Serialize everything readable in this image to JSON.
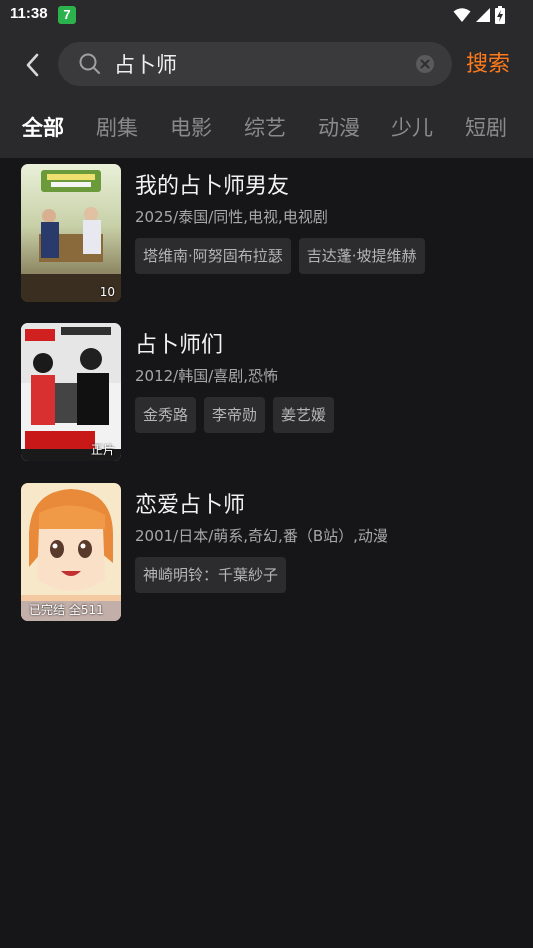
{
  "status_bar": {
    "time": "11:38",
    "notification_badge": "7",
    "icons": [
      "wifi-icon",
      "signal-icon",
      "battery-icon"
    ]
  },
  "header": {
    "back_icon": "chevron-left-icon",
    "search": {
      "value": "占卜师",
      "icon": "search-icon",
      "clear_icon": "clear-icon"
    },
    "search_button_label": "搜索",
    "accent_color": "#ff7a1a"
  },
  "tabs": [
    {
      "label": "全部",
      "active": true
    },
    {
      "label": "剧集",
      "active": false
    },
    {
      "label": "电影",
      "active": false
    },
    {
      "label": "综艺",
      "active": false
    },
    {
      "label": "动漫",
      "active": false
    },
    {
      "label": "少儿",
      "active": false
    },
    {
      "label": "短剧",
      "active": false
    }
  ],
  "results": [
    {
      "title": "我的占卜师男友",
      "meta": "2025/泰国/同性,电视,电视剧",
      "badge": "10",
      "tags": [
        "塔维南·阿努固布拉瑟",
        "吉达蓬·坡提维赫"
      ]
    },
    {
      "title": "占卜师们",
      "meta": "2012/韩国/喜剧,恐怖",
      "badge": "正片",
      "tags": [
        "金秀路",
        "李帝勋",
        "姜艺媛"
      ]
    },
    {
      "title": "恋爱占卜师",
      "meta": "2001/日本/萌系,奇幻,番（B站）,动漫",
      "badge": "已完结 全511",
      "tags": [
        "神崎明铃：千葉紗子"
      ]
    }
  ]
}
